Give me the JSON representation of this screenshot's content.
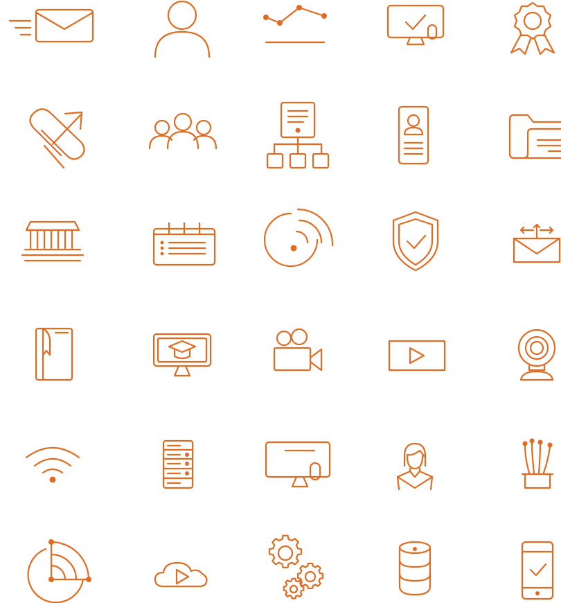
{
  "accent": "#e36a1e",
  "background": "#ffffff",
  "icons": [
    [
      "fast-email-icon",
      "user-icon",
      "line-chart-icon",
      "monitor-check-icon",
      "award-badge-icon"
    ],
    [
      "paperclip-arrow-icon",
      "group-icon",
      "sitemap-server-icon",
      "id-card-icon",
      "folder-document-icon"
    ],
    [
      "bank-building-icon",
      "calendar-list-icon",
      "radar-signal-icon",
      "shield-check-icon",
      "email-arrows-icon"
    ],
    [
      "book-bookmark-icon",
      "online-education-icon",
      "video-camera-icon",
      "video-play-icon",
      "webcam-icon"
    ],
    [
      "wifi-icon",
      "server-rack-icon",
      "desktop-computer-icon",
      "support-agent-icon",
      "fiber-optic-icon"
    ],
    [
      "pie-chart-icon",
      "cloud-play-icon",
      "gears-icon",
      "database-icon",
      "mobile-check-icon"
    ]
  ]
}
